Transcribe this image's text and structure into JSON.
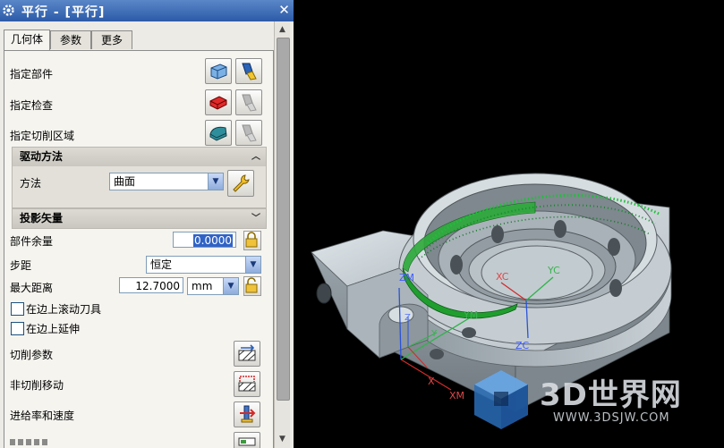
{
  "dialog": {
    "title": "平行 - [平行]",
    "tabs": [
      "几何体",
      "参数",
      "更多"
    ],
    "active_tab": "几何体"
  },
  "geometry": {
    "specify_part": "指定部件",
    "specify_check": "指定检查",
    "specify_cut_area": "指定切削区域"
  },
  "drive": {
    "header": "驱动方法",
    "method_label": "方法",
    "method_value": "曲面"
  },
  "projection": {
    "header": "投影矢量"
  },
  "params": {
    "part_stock_label": "部件余量",
    "part_stock_value": "0.0000",
    "stepover_label": "步距",
    "stepover_value": "恒定",
    "max_distance_label": "最大距离",
    "max_distance_value": "12.7000",
    "max_distance_unit": "mm",
    "roll_tool_label": "在边上滚动刀具",
    "extend_label": "在边上延伸"
  },
  "actions": {
    "cut_params": "切削参数",
    "non_cut_moves": "非切削移动",
    "feeds_speeds": "进给率和速度"
  },
  "viewport": {
    "axis_labels": [
      "ZM",
      "YM",
      "XC",
      "YC",
      "Z",
      "Y",
      "ZC",
      "X",
      "XM"
    ]
  },
  "watermark": {
    "brand": "3D世界网",
    "url": "WWW.3DSJW.COM"
  }
}
